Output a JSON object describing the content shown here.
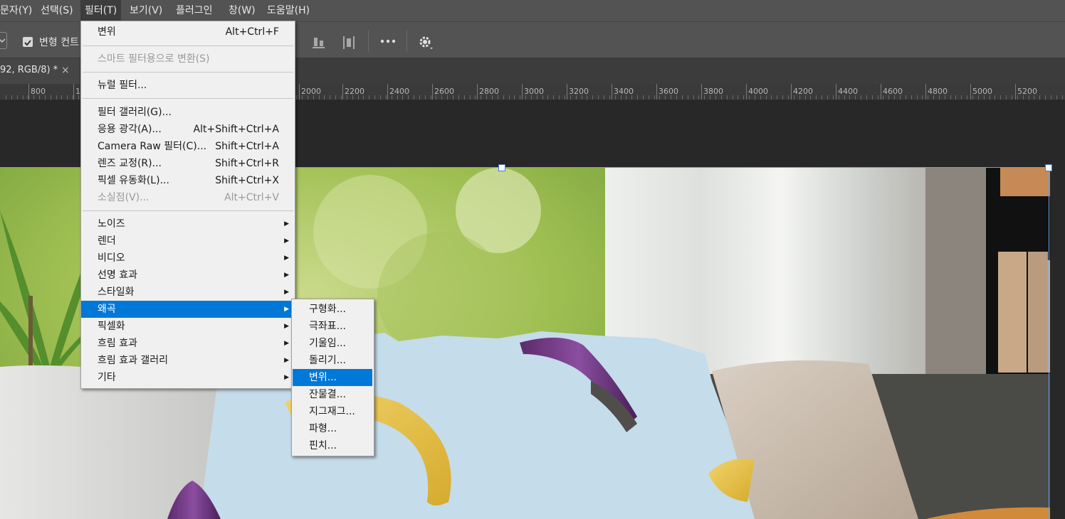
{
  "menubar": {
    "items": [
      "문자(Y)",
      "선택(S)",
      "필터(T)",
      "보기(V)",
      "플러그인",
      "창(W)",
      "도움말(H)"
    ]
  },
  "options": {
    "transform_checkbox_label": "변형 컨트"
  },
  "document_tab": {
    "title": "92, RGB/8) *",
    "close": "×"
  },
  "ruler": {
    "labels": [
      "800",
      "1",
      "2000",
      "2200",
      "2400",
      "2600",
      "2800",
      "3000",
      "3200",
      "3400",
      "3600",
      "3800",
      "4000",
      "4200",
      "4400",
      "4600",
      "4800",
      "5000",
      "5200"
    ]
  },
  "filter_menu": {
    "items": [
      {
        "label": "변위",
        "shortcut": "Alt+Ctrl+F"
      },
      {
        "label": "스마트 필터용으로 변환(S)",
        "disabled": true
      },
      {
        "label": "뉴럴 필터..."
      },
      {
        "label": "필터 갤러리(G)..."
      },
      {
        "label": "응용 광각(A)...",
        "shortcut": "Alt+Shift+Ctrl+A"
      },
      {
        "label": "Camera Raw 필터(C)...",
        "shortcut": "Shift+Ctrl+A"
      },
      {
        "label": "렌즈 교정(R)...",
        "shortcut": "Shift+Ctrl+R"
      },
      {
        "label": "픽셀 유동화(L)...",
        "shortcut": "Shift+Ctrl+X"
      },
      {
        "label": "소실점(V)...",
        "shortcut": "Alt+Ctrl+V",
        "disabled": true
      },
      {
        "label": "노이즈"
      },
      {
        "label": "렌더"
      },
      {
        "label": "비디오"
      },
      {
        "label": "선명 효과"
      },
      {
        "label": "스타일화"
      },
      {
        "label": "왜곡"
      },
      {
        "label": "픽셀화"
      },
      {
        "label": "흐림 효과"
      },
      {
        "label": "흐림 효과 갤러리"
      },
      {
        "label": "기타"
      }
    ]
  },
  "distort_submenu": {
    "items": [
      "구형화...",
      "극좌표...",
      "기울임...",
      "돌리기...",
      "변위...",
      "잔물결...",
      "지그재그...",
      "파형...",
      "핀치..."
    ],
    "selected": "변위..."
  },
  "colors": {
    "highlight": "#0078d7",
    "menu_bg": "#f0f0f0",
    "app_bg": "#535353"
  }
}
